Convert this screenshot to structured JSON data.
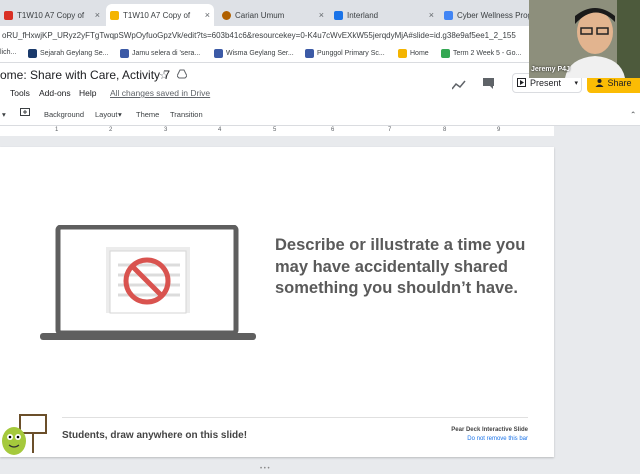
{
  "tabs": [
    {
      "label": "T1W10 A7 Copy of",
      "color": "#d93025",
      "active": false
    },
    {
      "label": "T1W10 A7 Copy of",
      "color": "#f4b400",
      "active": true
    },
    {
      "label": "Carian Umum",
      "color": "#b06000",
      "active": false
    },
    {
      "label": "Interland",
      "color": "#1a73e8",
      "active": false
    },
    {
      "label": "Cyber Wellness Progra",
      "color": "#4285f4",
      "active": false
    }
  ],
  "tab_close": "×",
  "url": "oRU_fHxwjKP_URyz2yFTgTwqpSWpOyfuoGpzVk/edit?ts=603b41c6&resourcekey=0-K4u7cWvEXkW55jerqdyMjA#slide=id.g38e9af5ee1_2_155",
  "bookmarks": [
    {
      "label": "lich...",
      "color": "#f4b400"
    },
    {
      "label": "Sejarah Geylang Se...",
      "color": "#1a3a6b"
    },
    {
      "label": "Jamu selera di 'sera...",
      "color": "#3c5aa6"
    },
    {
      "label": "Wisma Geylang Ser...",
      "color": "#3c5aa6"
    },
    {
      "label": "Punggol Primary Sc...",
      "color": "#3c5aa6"
    },
    {
      "label": "Home",
      "color": "#f4b400"
    },
    {
      "label": "Term 2 Week 5 - Go...",
      "color": "#34a853"
    }
  ],
  "doc": {
    "title": "ome: Share with Care, Activity 7",
    "star": "☆",
    "drive": "⛛",
    "menus": [
      "Tools",
      "Add-ons",
      "Help"
    ],
    "saved": "All changes saved in Drive",
    "present_label": "Present",
    "share_label": "Share"
  },
  "toolbar": {
    "items": [
      "Background",
      "Layout",
      "Theme",
      "Transition"
    ]
  },
  "ruler": [
    "1",
    "2",
    "3",
    "4",
    "5",
    "6",
    "7",
    "8",
    "9"
  ],
  "slide": {
    "prompt": "Describe or illustrate a time you may have accidentally shared something you shouldn’t have.",
    "footer": "Students, draw anywhere on this slide!",
    "pd_label": "Pear Deck Interactive Slide",
    "pd_link": "Do not remove this bar"
  },
  "webcam": {
    "name": "Jeremy P4J"
  },
  "colors": {
    "share": "#fbbc04",
    "link": "#1a73e8",
    "accent": "#d9534f"
  }
}
